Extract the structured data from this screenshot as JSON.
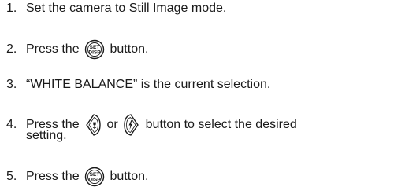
{
  "steps": [
    {
      "number": "1.",
      "text": "Set the camera to Still Image mode."
    },
    {
      "number": "2.",
      "before": "Press the",
      "button_icon": "set-disp-button-icon",
      "button_label_top": "SET",
      "button_label_bottom": "DISP",
      "after": "button."
    },
    {
      "number": "3.",
      "text": "“WHITE BALANCE” is the current selection."
    },
    {
      "number": "4.",
      "before": "Press the",
      "left_icon": "left-arrow-macro-button-icon",
      "middle": "or",
      "right_icon": "right-arrow-flash-button-icon",
      "after": "button to select the desired",
      "continuation": "setting."
    },
    {
      "number": "5.",
      "before": "Press the",
      "button_icon": "set-disp-button-icon",
      "button_label_top": "SET",
      "button_label_bottom": "DISP",
      "after": "button."
    }
  ]
}
